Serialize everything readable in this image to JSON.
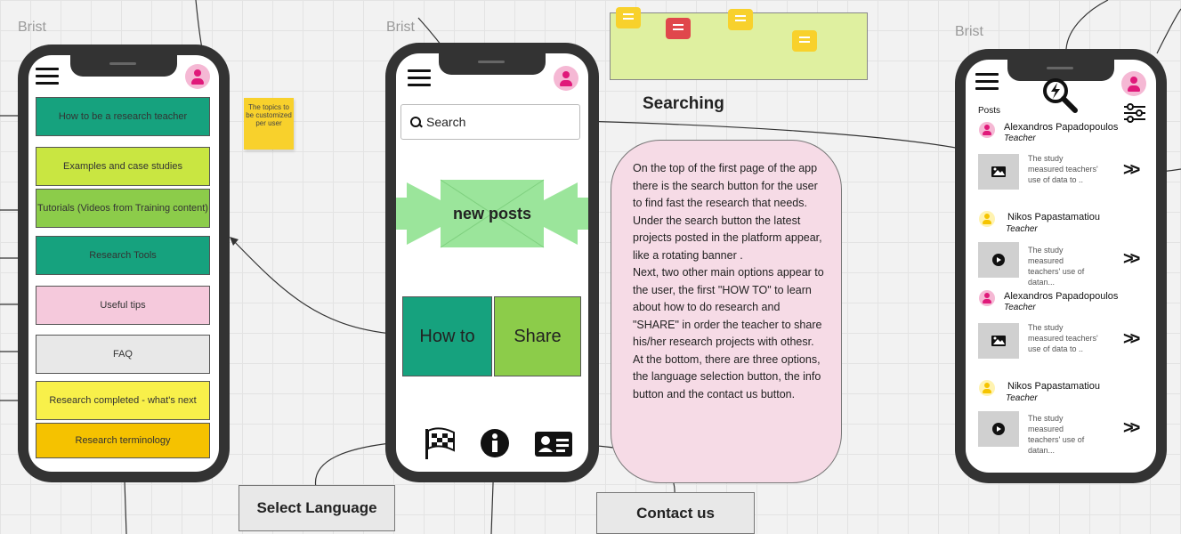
{
  "frame_labels": {
    "left": "Brist",
    "middle": "Brist",
    "right": "Brist"
  },
  "topics": [
    {
      "label": "How to be a research teacher",
      "color": "#16a27e"
    },
    {
      "label": "Examples and case studies",
      "color": "#c9e641"
    },
    {
      "label": "Tutorials (Videos from Training content)",
      "color": "#8ccc4a"
    },
    {
      "label": "Research Tools",
      "color": "#16a27e"
    },
    {
      "label": "Useful tips",
      "color": "#f5c9dc"
    },
    {
      "label": "FAQ",
      "color": "#e8e8e8"
    },
    {
      "label": "Research completed - what's next",
      "color": "#f8f04a"
    },
    {
      "label": "Research terminology",
      "color": "#f5c200"
    }
  ],
  "sticky_note": "The topics to be customized per user",
  "middle_phone": {
    "search_placeholder": "Search",
    "banner_label": "new posts",
    "how_to_label": "How to",
    "share_label": "Share"
  },
  "icons": {
    "language": "checkered-flag-icon",
    "info": "info-icon",
    "contact": "contact-card-icon",
    "search": "search-icon",
    "filter": "sliders-icon",
    "menu": "hamburger-icon"
  },
  "searching_title": "Searching",
  "description": "On the top of the first page of the app there is the search button for the user to find fast the research that needs.\nUnder the search button the latest projects posted in the platform appear, like a rotating banner .\nNext, two other main options appear to the user, the first \"HOW TO\" to learn about how to do research and  \"SHARE\" in order the teacher to share his/her research projects with othesr.\nAt the bottom, there are three options, the language selection button, the info button and the contact us button.",
  "select_language": "Select Language",
  "contact_us": "Contact us",
  "right_phone": {
    "posts_label": "Posts",
    "posts": [
      {
        "name": "Alexandros Papadopoulos",
        "role": "Teacher",
        "text": "The study measured teachers' use of data to ..",
        "media": "image-icon",
        "avatar": "pink"
      },
      {
        "name": "Nikos Papastamatiou",
        "role": "Teacher",
        "text": "The study measured teachers' use of datan...",
        "media": "play-icon",
        "avatar": "yellow"
      },
      {
        "name": "Alexandros Papadopoulos",
        "role": "Teacher",
        "text": "The study measured teachers' use of data to ..",
        "media": "image-icon",
        "avatar": "pink"
      },
      {
        "name": "Nikos Papastamatiou",
        "role": "Teacher",
        "text": "The study measured teachers' use of datan...",
        "media": "play-icon",
        "avatar": "yellow"
      }
    ]
  },
  "colors": {
    "phone_frame": "#333333",
    "how_to": "#16a27e",
    "share": "#8ccc4a",
    "banner": "#9be59b",
    "description_bg": "#f6dbe6",
    "comment_area": "#dff0a0"
  }
}
